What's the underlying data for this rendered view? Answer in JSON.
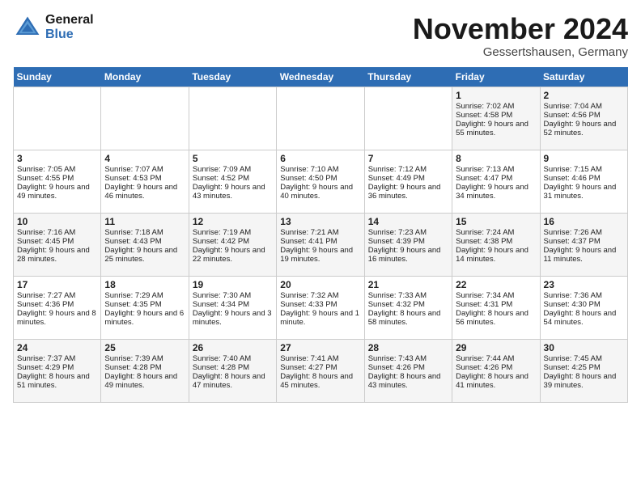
{
  "header": {
    "logo_line1": "General",
    "logo_line2": "Blue",
    "month_title": "November 2024",
    "location": "Gessertshausen, Germany"
  },
  "days_of_week": [
    "Sunday",
    "Monday",
    "Tuesday",
    "Wednesday",
    "Thursday",
    "Friday",
    "Saturday"
  ],
  "weeks": [
    [
      {
        "day": "",
        "info": ""
      },
      {
        "day": "",
        "info": ""
      },
      {
        "day": "",
        "info": ""
      },
      {
        "day": "",
        "info": ""
      },
      {
        "day": "",
        "info": ""
      },
      {
        "day": "1",
        "info": "Sunrise: 7:02 AM\nSunset: 4:58 PM\nDaylight: 9 hours and 55 minutes."
      },
      {
        "day": "2",
        "info": "Sunrise: 7:04 AM\nSunset: 4:56 PM\nDaylight: 9 hours and 52 minutes."
      }
    ],
    [
      {
        "day": "3",
        "info": "Sunrise: 7:05 AM\nSunset: 4:55 PM\nDaylight: 9 hours and 49 minutes."
      },
      {
        "day": "4",
        "info": "Sunrise: 7:07 AM\nSunset: 4:53 PM\nDaylight: 9 hours and 46 minutes."
      },
      {
        "day": "5",
        "info": "Sunrise: 7:09 AM\nSunset: 4:52 PM\nDaylight: 9 hours and 43 minutes."
      },
      {
        "day": "6",
        "info": "Sunrise: 7:10 AM\nSunset: 4:50 PM\nDaylight: 9 hours and 40 minutes."
      },
      {
        "day": "7",
        "info": "Sunrise: 7:12 AM\nSunset: 4:49 PM\nDaylight: 9 hours and 36 minutes."
      },
      {
        "day": "8",
        "info": "Sunrise: 7:13 AM\nSunset: 4:47 PM\nDaylight: 9 hours and 34 minutes."
      },
      {
        "day": "9",
        "info": "Sunrise: 7:15 AM\nSunset: 4:46 PM\nDaylight: 9 hours and 31 minutes."
      }
    ],
    [
      {
        "day": "10",
        "info": "Sunrise: 7:16 AM\nSunset: 4:45 PM\nDaylight: 9 hours and 28 minutes."
      },
      {
        "day": "11",
        "info": "Sunrise: 7:18 AM\nSunset: 4:43 PM\nDaylight: 9 hours and 25 minutes."
      },
      {
        "day": "12",
        "info": "Sunrise: 7:19 AM\nSunset: 4:42 PM\nDaylight: 9 hours and 22 minutes."
      },
      {
        "day": "13",
        "info": "Sunrise: 7:21 AM\nSunset: 4:41 PM\nDaylight: 9 hours and 19 minutes."
      },
      {
        "day": "14",
        "info": "Sunrise: 7:23 AM\nSunset: 4:39 PM\nDaylight: 9 hours and 16 minutes."
      },
      {
        "day": "15",
        "info": "Sunrise: 7:24 AM\nSunset: 4:38 PM\nDaylight: 9 hours and 14 minutes."
      },
      {
        "day": "16",
        "info": "Sunrise: 7:26 AM\nSunset: 4:37 PM\nDaylight: 9 hours and 11 minutes."
      }
    ],
    [
      {
        "day": "17",
        "info": "Sunrise: 7:27 AM\nSunset: 4:36 PM\nDaylight: 9 hours and 8 minutes."
      },
      {
        "day": "18",
        "info": "Sunrise: 7:29 AM\nSunset: 4:35 PM\nDaylight: 9 hours and 6 minutes."
      },
      {
        "day": "19",
        "info": "Sunrise: 7:30 AM\nSunset: 4:34 PM\nDaylight: 9 hours and 3 minutes."
      },
      {
        "day": "20",
        "info": "Sunrise: 7:32 AM\nSunset: 4:33 PM\nDaylight: 9 hours and 1 minute."
      },
      {
        "day": "21",
        "info": "Sunrise: 7:33 AM\nSunset: 4:32 PM\nDaylight: 8 hours and 58 minutes."
      },
      {
        "day": "22",
        "info": "Sunrise: 7:34 AM\nSunset: 4:31 PM\nDaylight: 8 hours and 56 minutes."
      },
      {
        "day": "23",
        "info": "Sunrise: 7:36 AM\nSunset: 4:30 PM\nDaylight: 8 hours and 54 minutes."
      }
    ],
    [
      {
        "day": "24",
        "info": "Sunrise: 7:37 AM\nSunset: 4:29 PM\nDaylight: 8 hours and 51 minutes."
      },
      {
        "day": "25",
        "info": "Sunrise: 7:39 AM\nSunset: 4:28 PM\nDaylight: 8 hours and 49 minutes."
      },
      {
        "day": "26",
        "info": "Sunrise: 7:40 AM\nSunset: 4:28 PM\nDaylight: 8 hours and 47 minutes."
      },
      {
        "day": "27",
        "info": "Sunrise: 7:41 AM\nSunset: 4:27 PM\nDaylight: 8 hours and 45 minutes."
      },
      {
        "day": "28",
        "info": "Sunrise: 7:43 AM\nSunset: 4:26 PM\nDaylight: 8 hours and 43 minutes."
      },
      {
        "day": "29",
        "info": "Sunrise: 7:44 AM\nSunset: 4:26 PM\nDaylight: 8 hours and 41 minutes."
      },
      {
        "day": "30",
        "info": "Sunrise: 7:45 AM\nSunset: 4:25 PM\nDaylight: 8 hours and 39 minutes."
      }
    ]
  ]
}
